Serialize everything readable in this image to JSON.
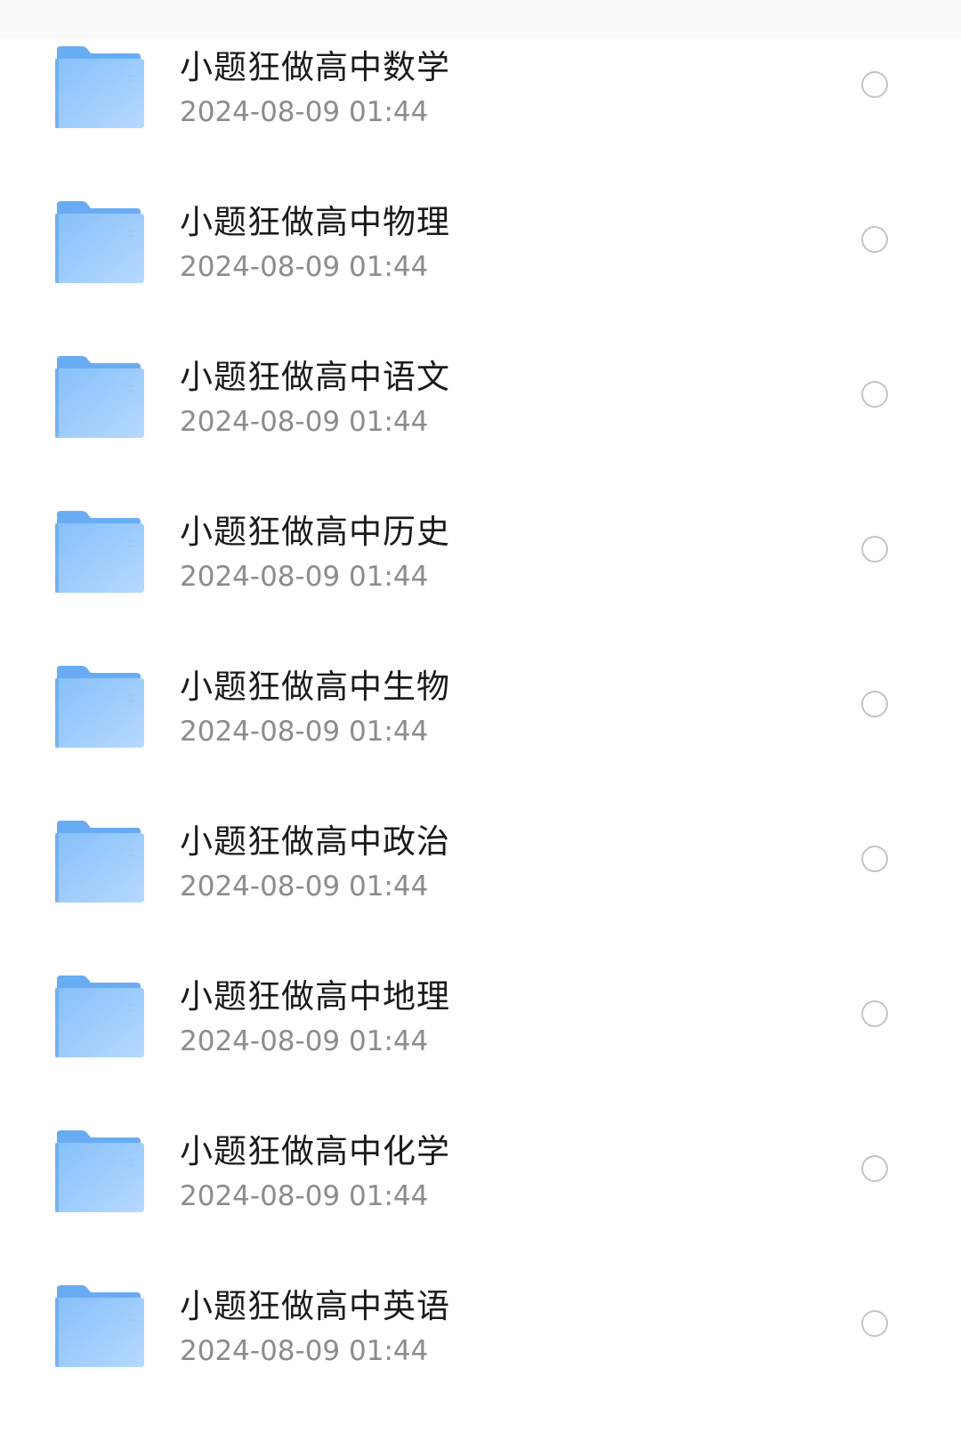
{
  "files": [
    {
      "name": "小题狂做高中数学",
      "date": "2024-08-09 01:44",
      "icon": "folder-icon"
    },
    {
      "name": "小题狂做高中物理",
      "date": "2024-08-09 01:44",
      "icon": "folder-icon"
    },
    {
      "name": "小题狂做高中语文",
      "date": "2024-08-09 01:44",
      "icon": "folder-icon"
    },
    {
      "name": "小题狂做高中历史",
      "date": "2024-08-09 01:44",
      "icon": "folder-icon"
    },
    {
      "name": "小题狂做高中生物",
      "date": "2024-08-09 01:44",
      "icon": "folder-icon"
    },
    {
      "name": "小题狂做高中政治",
      "date": "2024-08-09 01:44",
      "icon": "folder-icon"
    },
    {
      "name": "小题狂做高中地理",
      "date": "2024-08-09 01:44",
      "icon": "folder-icon"
    },
    {
      "name": "小题狂做高中化学",
      "date": "2024-08-09 01:44",
      "icon": "folder-icon"
    },
    {
      "name": "小题狂做高中英语",
      "date": "2024-08-09 01:44",
      "icon": "folder-icon"
    }
  ],
  "colors": {
    "folder_back": "#6aaef5",
    "folder_front_top": "#8cc3fb",
    "folder_front_bottom": "#b3d8ff",
    "radio_border": "#c4c4c4"
  }
}
